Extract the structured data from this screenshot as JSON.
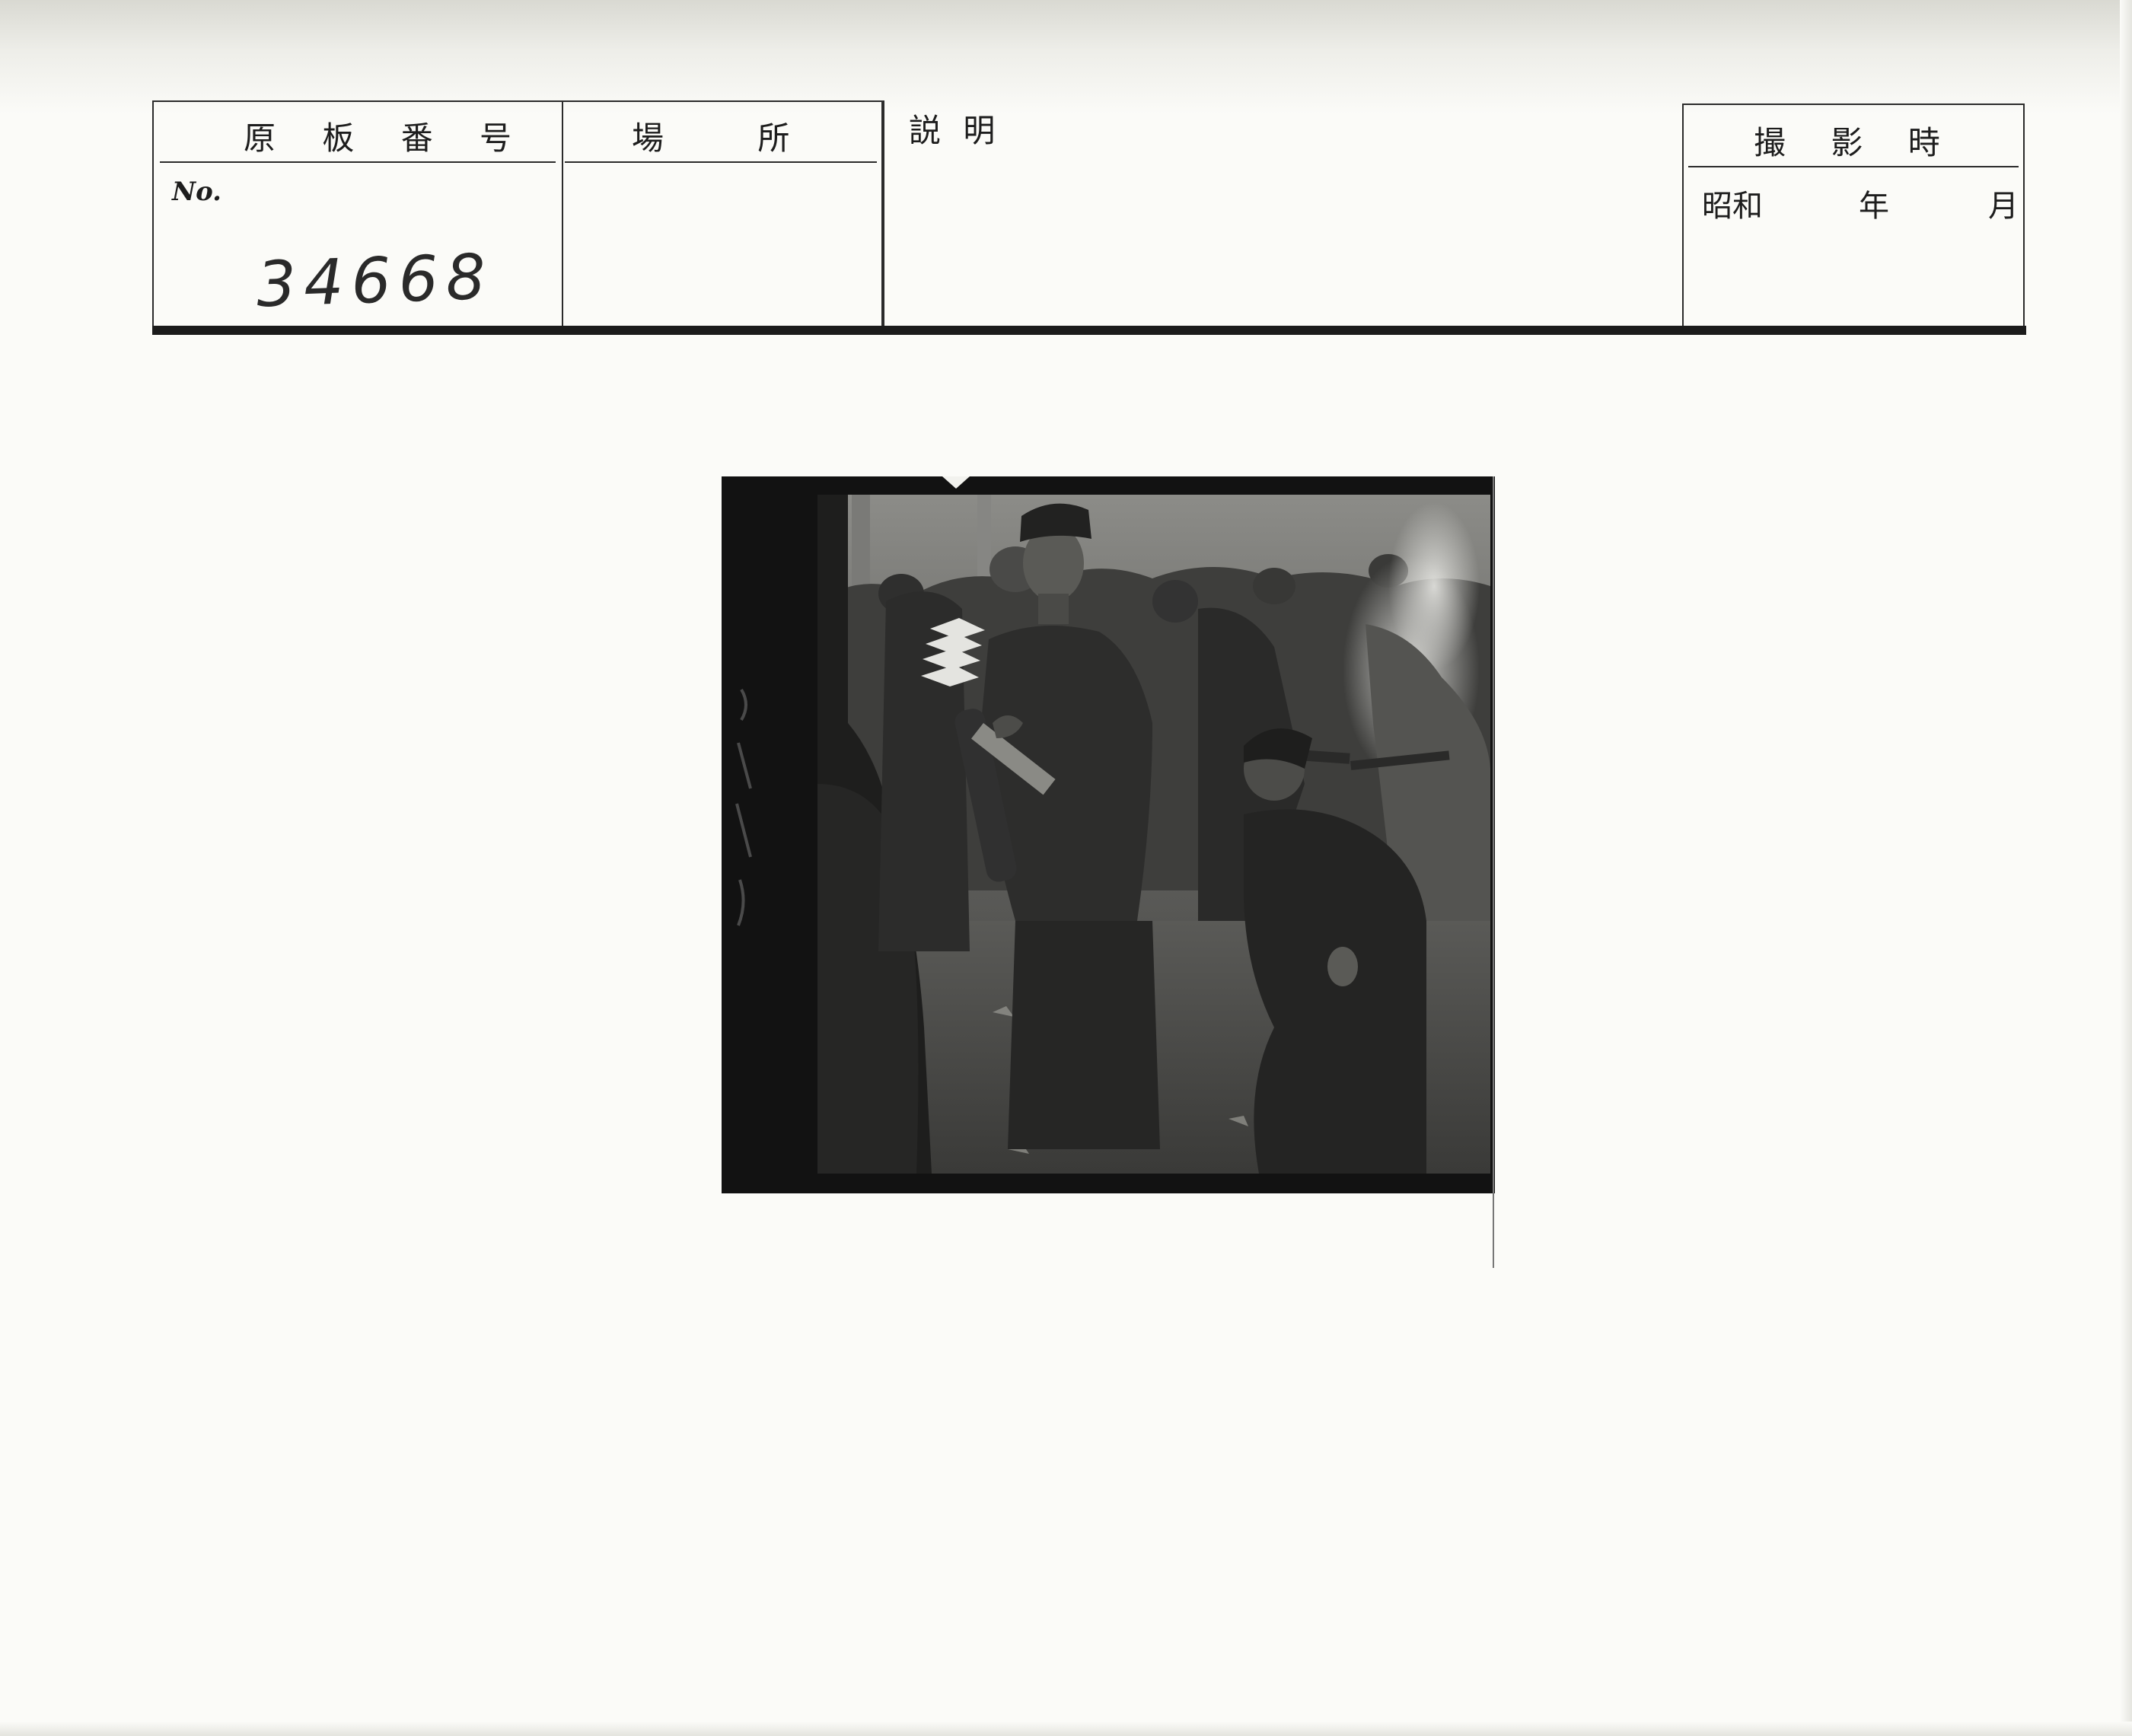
{
  "form": {
    "plate_number_header": "原 板 番 号",
    "plate_number_prefix": "No.",
    "plate_number_value": "34668",
    "place_header": "場 所",
    "description_header": "説 明",
    "date_header": "撮 影 時",
    "date_era": "昭和",
    "date_year_label": "年",
    "date_month_label": "月"
  },
  "photo": {
    "description": "archival black-and-white photograph in a film negative frame"
  },
  "colors": {
    "paper": "#fbfbf8",
    "ink": "#1d1d1d",
    "film_border": "#121212"
  }
}
